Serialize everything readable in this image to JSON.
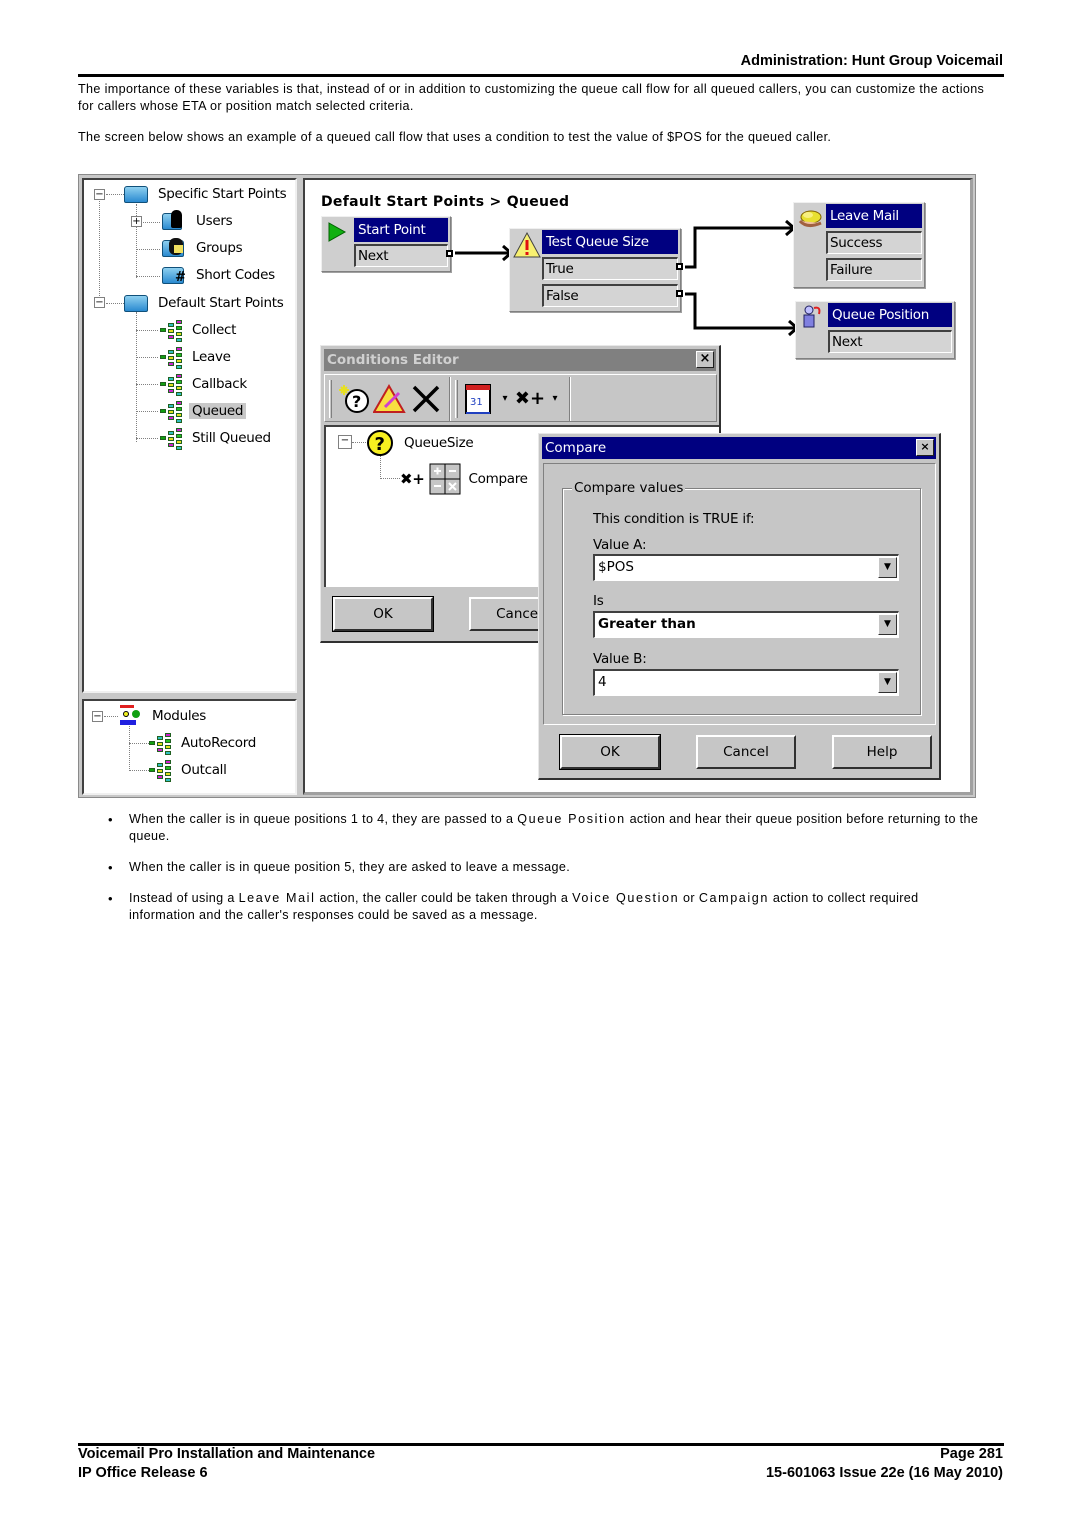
{
  "header": {
    "title": "Administration: Hunt Group Voicemail"
  },
  "paragraphs": [
    "The importance of these variables is that, instead of or in addition to customizing the queue call flow for all queued callers, you can customize the actions for callers whose ETA or position match selected criteria.",
    "The screen below shows an example of a queued call flow that uses a condition to test the value of $POS for the queued caller."
  ],
  "screenshot": {
    "tree": {
      "specific": {
        "label": "Specific Start Points",
        "children": [
          "Users",
          "Groups",
          "Short Codes"
        ]
      },
      "default": {
        "label": "Default Start Points",
        "children": [
          "Collect",
          "Leave",
          "Callback",
          "Queued",
          "Still Queued"
        ],
        "selected": "Queued"
      },
      "modules": {
        "label": "Modules",
        "children": [
          "AutoRecord",
          "Outcall"
        ]
      }
    },
    "canvas": {
      "title": "Default Start Points > Queued",
      "nodes": {
        "start": {
          "title": "Start Point",
          "outputs": [
            "Next"
          ],
          "icon": "start-arrow-icon"
        },
        "test": {
          "title": "Test Queue Size",
          "outputs": [
            "True",
            "False"
          ],
          "icon": "warning-condition-icon"
        },
        "leavemail": {
          "title": "Leave Mail",
          "outputs": [
            "Success",
            "Failure"
          ],
          "icon": "leave-mail-hand-icon"
        },
        "queuepos": {
          "title": "Queue Position",
          "outputs": [
            "Next"
          ],
          "icon": "queue-person-icon"
        }
      }
    },
    "conditions_editor": {
      "title": "Conditions Editor",
      "close": "×",
      "toolbar": [
        "new-condition",
        "edit-condition",
        "delete",
        "calendar",
        "compare-dropdown"
      ],
      "tree": {
        "root": "QueueSize",
        "child": "Compare"
      },
      "ok": "OK",
      "cancel": "Cancel"
    },
    "compare_dialog": {
      "title": "Compare",
      "close": "×",
      "group_label": "Compare values",
      "intro": "This condition is TRUE if:",
      "value_a_label": "Value A:",
      "value_a": "$POS",
      "is_label": "Is",
      "is_value": "Greater than",
      "value_b_label": "Value B:",
      "value_b": "4",
      "ok": "OK",
      "cancel": "Cancel",
      "help": "Help"
    }
  },
  "bullets": [
    {
      "pre": "When the caller is in queue positions 1 to 4, they are passed to a ",
      "term": "Queue Position",
      "post": " action and hear their queue position before returning to the queue."
    },
    {
      "pre": "When the caller is in queue position 5, they are asked to leave a message.",
      "term": "",
      "post": ""
    },
    {
      "pre": "Instead of using a ",
      "term": "Leave Mail",
      "mid": " action, the caller could be taken through a ",
      "term2": "Voice Question",
      "mid2": " or ",
      "term3": "Campaign",
      "post": " action to collect required information and the caller's responses could be saved as a message."
    }
  ],
  "footer": {
    "left1": "Voicemail Pro Installation and Maintenance",
    "left2": "IP Office Release 6",
    "right1": "Page 281",
    "right2": "15-601063 Issue 22e (16 May 2010)"
  },
  "colors": {
    "title_bar_active": "#000080",
    "title_bar_inactive": "#808080",
    "dialog_face": "#c6c6c6"
  }
}
